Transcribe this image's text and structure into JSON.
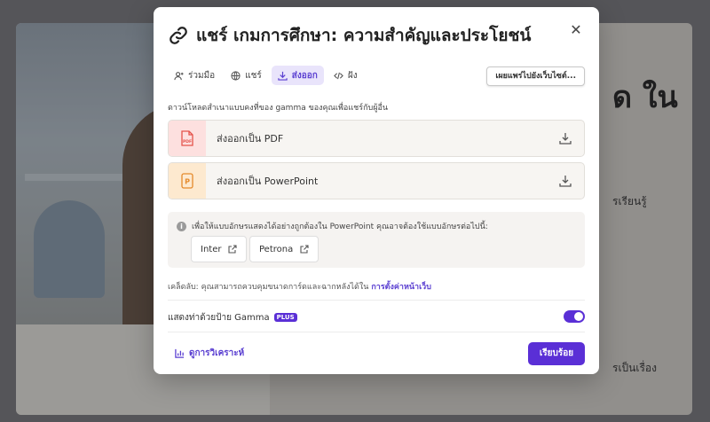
{
  "background": {
    "title": "ด ใน",
    "text1": "รเรียนรู้",
    "text2": "รเป็นเรื่อง"
  },
  "modal": {
    "title": "แชร์ เกมการศึกษา: ความสำคัญและประโยชน์",
    "close_symbol": "✕",
    "tabs": [
      {
        "label": "ร่วมมือ",
        "icon": "add-person-icon"
      },
      {
        "label": "แชร์",
        "icon": "globe-icon"
      },
      {
        "label": "ส่งออก",
        "icon": "download-icon",
        "active": true
      },
      {
        "label": "ฝัง",
        "icon": "code-icon"
      }
    ],
    "publish_label": "เผยแพร่ไปยังเว็บไซต์...",
    "description": "ดาวน์โหลดสำเนาแบบคงที่ของ gamma ของคุณเพื่อแชร์กับผู้อื่น",
    "exports": [
      {
        "label": "ส่งออกเป็น PDF",
        "badge_text": "PDF",
        "color": "#e5534b"
      },
      {
        "label": "ส่งออกเป็น PowerPoint",
        "badge_text": "P",
        "color": "#e58a2b"
      }
    ],
    "font_note": "เพื่อให้แบบอักษรแสดงได้อย่างถูกต้องใน PowerPoint คุณอาจต้องใช้แบบอักษรต่อไปนี้:",
    "fonts": [
      "Inter",
      "Petrona"
    ],
    "tip_prefix": "เคล็ดลับ: คุณสามารถควบคุมขนาดการ์ดและฉากหลังได้ใน",
    "tip_link": "การตั้งค่าหน้าเว็บ",
    "gamma_label": "แสดงท่าด้วยป้าย Gamma",
    "plus_badge": "PLUS",
    "gamma_toggle_on": true,
    "analytics_label": "ดูการวิเคราะห์",
    "done_label": "เรียบร้อย",
    "accent_color": "#5a2fd6"
  }
}
